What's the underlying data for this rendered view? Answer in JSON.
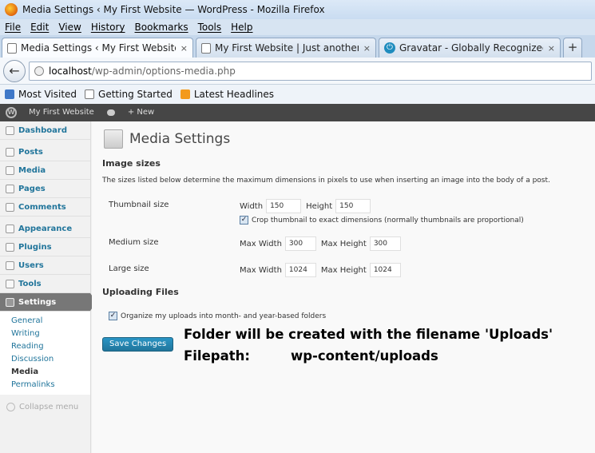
{
  "window": {
    "title": "Media Settings ‹ My First Website — WordPress - Mozilla Firefox"
  },
  "menubar": [
    "File",
    "Edit",
    "View",
    "History",
    "Bookmarks",
    "Tools",
    "Help"
  ],
  "tabs": [
    {
      "label": "Media Settings ‹ My First Website — ...",
      "close": "×"
    },
    {
      "label": "My First Website | Just another Word...",
      "close": "×"
    },
    {
      "label": "Gravatar - Globally Recognized Avatars",
      "close": "×"
    }
  ],
  "newtab": "+",
  "url": {
    "host": "localhost",
    "path": "/wp-admin/options-media.php"
  },
  "bookmarks": [
    "Most Visited",
    "Getting Started",
    "Latest Headlines"
  ],
  "adminbar": {
    "site": "My First Website",
    "new": "+ New"
  },
  "sidebar": {
    "items_top": [
      "Dashboard"
    ],
    "items_mid": [
      "Posts",
      "Media",
      "Pages",
      "Comments"
    ],
    "items_low": [
      "Appearance",
      "Plugins",
      "Users",
      "Tools"
    ],
    "active": "Settings",
    "submenu": [
      "General",
      "Writing",
      "Reading",
      "Discussion",
      "Media",
      "Permalinks"
    ],
    "collapse": "Collapse menu"
  },
  "main": {
    "title": "Media Settings",
    "image_sizes": {
      "heading": "Image sizes",
      "desc": "The sizes listed below determine the maximum dimensions in pixels to use when inserting an image into the body of a post.",
      "thumbnail": {
        "label": "Thumbnail size",
        "width_label": "Width",
        "width": "150",
        "height_label": "Height",
        "height": "150",
        "crop_label": "Crop thumbnail to exact dimensions (normally thumbnails are proportional)",
        "crop_checked": true
      },
      "medium": {
        "label": "Medium size",
        "maxw_label": "Max Width",
        "maxw": "300",
        "maxh_label": "Max Height",
        "maxh": "300"
      },
      "large": {
        "label": "Large size",
        "maxw_label": "Max Width",
        "maxw": "1024",
        "maxh_label": "Max Height",
        "maxh": "1024"
      }
    },
    "uploading": {
      "heading": "Uploading Files",
      "organize_label": "Organize my uploads into month- and year-based folders",
      "organize_checked": true
    },
    "save_label": "Save Changes"
  },
  "annotation": {
    "line1": "Folder will be created with the filename 'Uploads'",
    "filepath_label": "Filepath:",
    "filepath_value": "wp-content/uploads"
  }
}
